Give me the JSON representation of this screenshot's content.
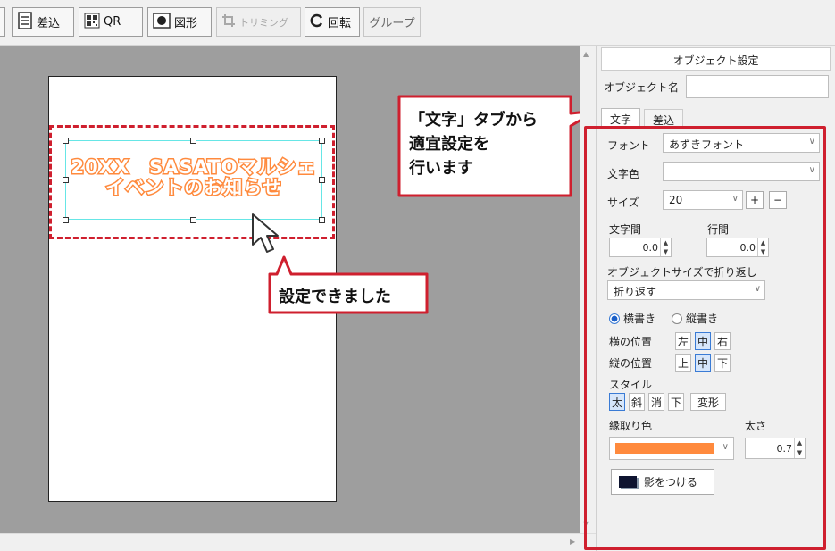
{
  "toolbar": {
    "merge": "差込",
    "qr": "QR",
    "shape": "図形",
    "trim": "トリミング",
    "rotate": "回転",
    "group": "グループ"
  },
  "canvas": {
    "headline_line1": "20XX　SASATOマルシェ",
    "headline_line2": "イベントのお知らせ",
    "headline_color": "#ff8a3d"
  },
  "callouts": {
    "tab_hint_line1": "「文字」タブから",
    "tab_hint_line2": "適宜設定を",
    "tab_hint_line3": "行います",
    "done": "設定できました",
    "accent": "#cf1f2e"
  },
  "panel": {
    "header": "オブジェクト設定",
    "name_label": "オブジェクト名",
    "name_value": "",
    "tabs": {
      "text": "文字",
      "merge": "差込"
    },
    "font_label": "フォント",
    "font_value": "あずきフォント",
    "color_label": "文字色",
    "color_value": "",
    "size_label": "サイズ",
    "size_value": "20",
    "size_plus": "+",
    "size_minus": "−",
    "char_spacing_label": "文字間",
    "char_spacing_value": "0.0",
    "line_spacing_label": "行間",
    "line_spacing_value": "0.0",
    "wrap_label": "オブジェクトサイズで折り返し",
    "wrap_value": "折り返す",
    "horizontal_label": "横書き",
    "vertical_label": "縦書き",
    "h_pos_label": "横の位置",
    "h_pos": [
      "左",
      "中",
      "右"
    ],
    "v_pos_label": "縦の位置",
    "v_pos": [
      "上",
      "中",
      "下"
    ],
    "style_label": "スタイル",
    "styles": [
      "太",
      "斜",
      "消",
      "下"
    ],
    "transform": "変形",
    "outline_label": "縁取り色",
    "outline_color": "#ff8a3d",
    "thickness_label": "太さ",
    "thickness_value": "0.7",
    "shadow_button": "影をつける"
  }
}
